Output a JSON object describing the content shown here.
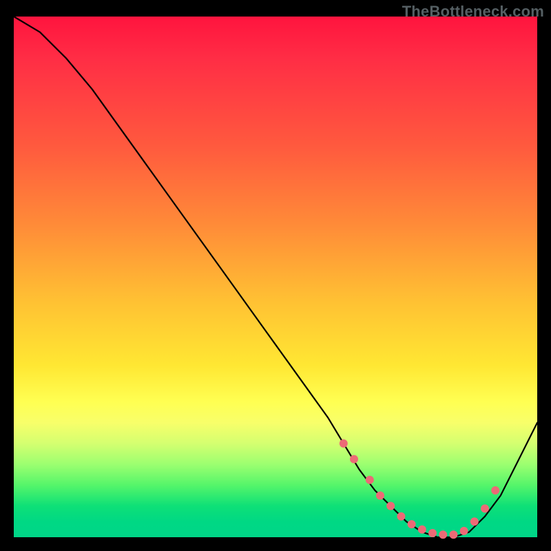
{
  "watermark": "TheBottleneck.com",
  "chart_data": {
    "type": "line",
    "title": "",
    "xlabel": "",
    "ylabel": "",
    "xlim": [
      0,
      100
    ],
    "ylim": [
      0,
      100
    ],
    "series": [
      {
        "name": "curve",
        "x": [
          0,
          5,
          10,
          15,
          20,
          25,
          30,
          35,
          40,
          45,
          50,
          55,
          60,
          63,
          66,
          69,
          72,
          75,
          78,
          81,
          84,
          87,
          90,
          93,
          96,
          100
        ],
        "y": [
          100,
          97,
          92,
          86,
          79,
          72,
          65,
          58,
          51,
          44,
          37,
          30,
          23,
          18,
          13,
          9,
          6,
          3,
          1,
          0,
          0,
          1,
          4,
          8,
          14,
          22
        ]
      }
    ],
    "markers": {
      "name": "highlight-dots",
      "color": "#ec6a76",
      "x": [
        63,
        65,
        68,
        70,
        72,
        74,
        76,
        78,
        80,
        82,
        84,
        86,
        88,
        90,
        92
      ],
      "y": [
        18,
        15,
        11,
        8,
        6,
        4,
        2.5,
        1.5,
        0.8,
        0.5,
        0.5,
        1.2,
        3,
        5.5,
        9
      ]
    }
  }
}
